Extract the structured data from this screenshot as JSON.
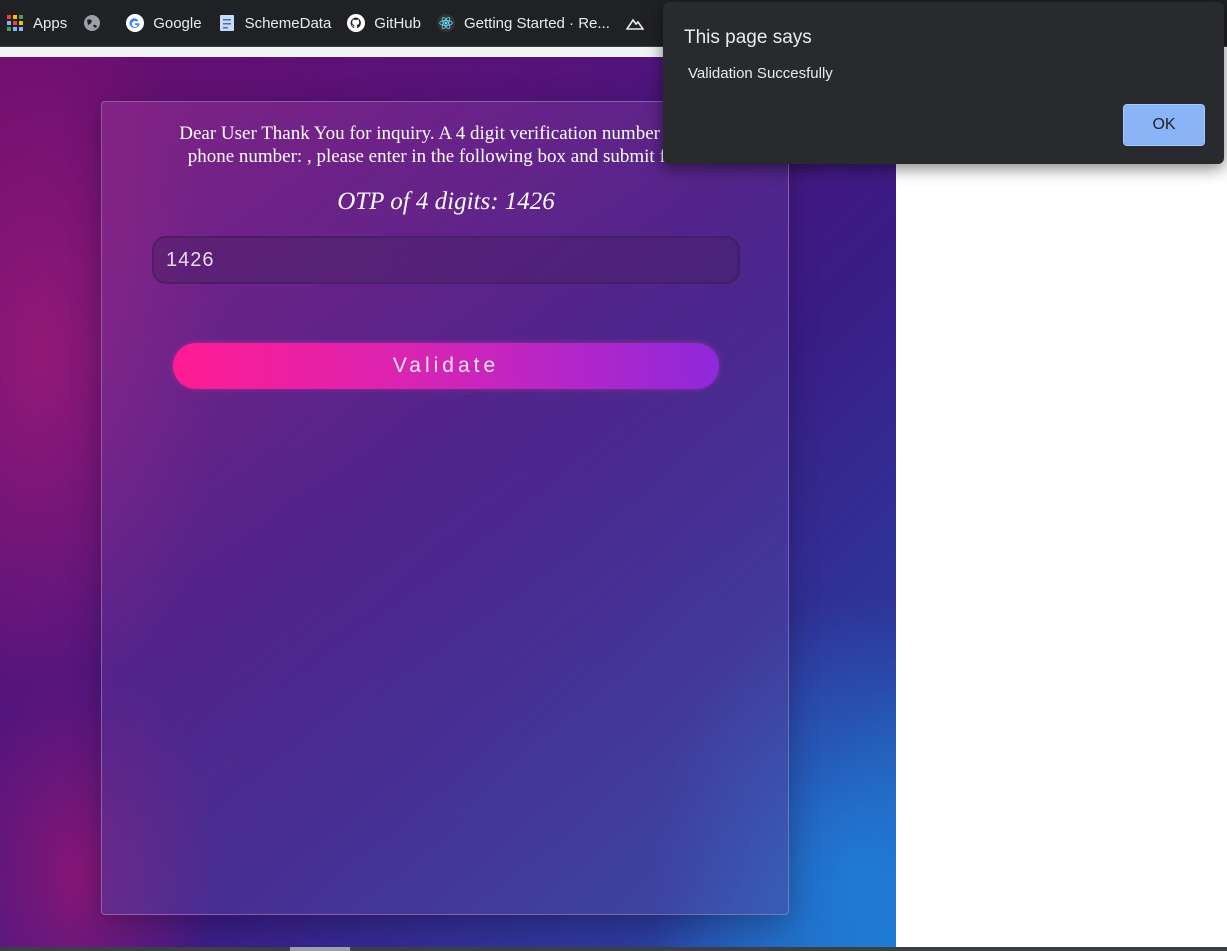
{
  "bookmarks": [
    {
      "label": "Apps",
      "icon": "apps-grid-icon"
    },
    {
      "label": "",
      "icon": "globe-icon"
    },
    {
      "label": "Google",
      "icon": "google-icon"
    },
    {
      "label": "SchemeData",
      "icon": "document-icon"
    },
    {
      "label": "GitHub",
      "icon": "github-icon"
    },
    {
      "label": "Getting Started · Re...",
      "icon": "react-icon"
    }
  ],
  "card": {
    "message_line1": "Dear User Thank You for inquiry. A 4 digit verification number has be",
    "message_line2": "phone number: , please enter in the following box and submit for co",
    "otp_title": "OTP of 4 digits: 1426",
    "otp_value": "1426",
    "validate_label": "Validate"
  },
  "dialog": {
    "title": "This page says",
    "message": "Validation Succesfully",
    "ok_label": "OK",
    "ok_color": "#8ab4f8"
  },
  "colors": {
    "button_gradient_start": "#ff1b92",
    "button_gradient_end": "#8f28dc"
  }
}
